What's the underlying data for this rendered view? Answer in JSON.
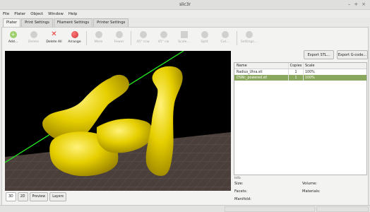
{
  "window": {
    "title": "slic3r",
    "controls": [
      "–",
      "+",
      "×"
    ]
  },
  "menu": [
    "File",
    "Plater",
    "Object",
    "Window",
    "Help"
  ],
  "tabs": [
    "Plater",
    "Print Settings",
    "Filament Settings",
    "Printer Settings"
  ],
  "toolbar": {
    "add": "Add...",
    "delete": "Delete",
    "delete_all": "Delete All",
    "arrange": "Arrange",
    "more": "More",
    "fewer": "Fewer",
    "rot_cw": "45° ccw",
    "rot_ccw": "45° cw",
    "scale": "Scale...",
    "split": "Split",
    "cut": "Cut...",
    "settings": "Settings..."
  },
  "export_stl": "Export STL...",
  "export_gcode": "Export G-code...",
  "object_list": {
    "headers": {
      "name": "Name",
      "copies": "Copies",
      "scale": "Scale"
    },
    "rows": [
      {
        "name": "Radius_Ulna.stl",
        "copies": "1",
        "scale": "100%",
        "selected": false
      },
      {
        "name": "DSNc_powered.stl",
        "copies": "1",
        "scale": "100%",
        "selected": true
      }
    ]
  },
  "info": {
    "title": "Info",
    "size": "Size:",
    "volume": "Volume:",
    "facets": "Facets:",
    "materials": "Materials:",
    "manifold": "Manifold:"
  },
  "view_tabs": [
    "3D",
    "2D",
    "Preview",
    "Layers"
  ],
  "colors": {
    "model": "#e6cf00",
    "selection": "#8aa85d",
    "axis": "#22ee22",
    "bed": "#4a3f3a"
  }
}
